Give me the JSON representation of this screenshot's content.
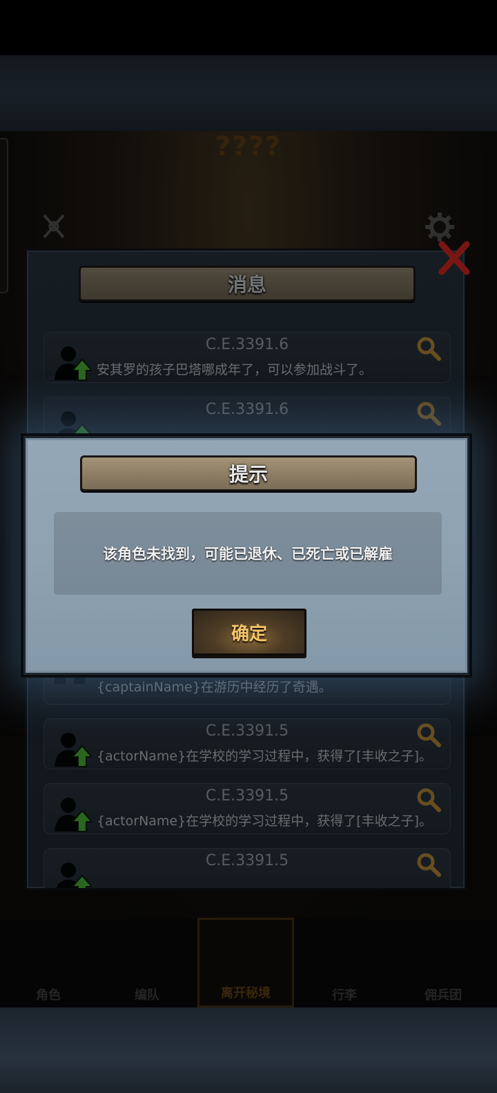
{
  "map": {
    "title": "????"
  },
  "messages_panel": {
    "title": "消息",
    "rows": [
      {
        "date": "C.E.3391.6",
        "text": "安其罗的孩子巴塔哪成年了，可以参加战斗了。",
        "icon": "person-up-icon"
      },
      {
        "date": "C.E.3391.6",
        "text": "",
        "icon": "person-up-icon"
      },
      {
        "date": "",
        "text": "{captainName}在游历中经历了奇遇。",
        "icon": "castle-icon"
      },
      {
        "date": "C.E.3391.5",
        "text": "{actorName}在学校的学习过程中，获得了[丰收之子]。",
        "icon": "person-up-icon"
      },
      {
        "date": "C.E.3391.5",
        "text": "{actorName}在学校的学习过程中，获得了[丰收之子]。",
        "icon": "person-up-icon"
      },
      {
        "date": "C.E.3391.5",
        "text": "",
        "icon": "person-up-icon"
      }
    ]
  },
  "bottom_nav": {
    "items": [
      {
        "label": "角色"
      },
      {
        "label": "编队"
      },
      {
        "label": "离开秘境"
      },
      {
        "label": "行李"
      },
      {
        "label": "佣兵团"
      }
    ]
  },
  "dialog": {
    "title": "提示",
    "message": "该角色未找到，可能已退休、已死亡或已解雇",
    "confirm_label": "确定"
  },
  "colors": {
    "dialog_bg": "#8fa2b1",
    "banner": "#8a7b62",
    "confirm_text": "#f6c56a",
    "close_red": "#b8231c",
    "arrow_green": "#4db33a"
  }
}
